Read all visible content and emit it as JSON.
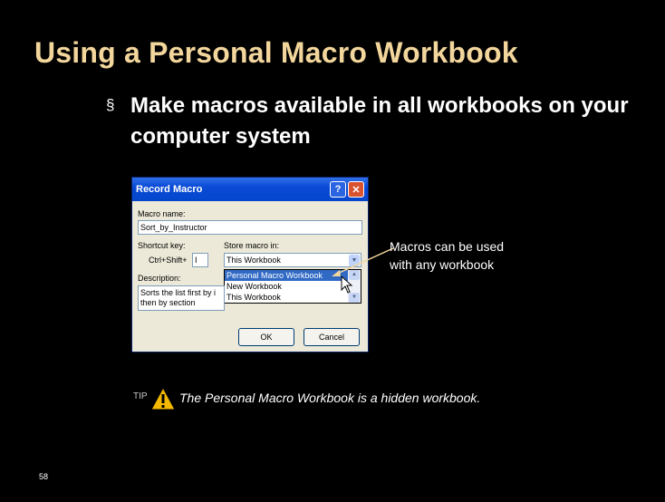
{
  "slide": {
    "title": "Using a Personal Macro Workbook",
    "bullet_marker": "§",
    "bullet_text": "Make macros available in all workbooks on your computer system",
    "page_number": "58"
  },
  "dialog": {
    "title": "Record Macro",
    "help_label": "?",
    "close_label": "✕",
    "macro_name_label": "Macro name:",
    "macro_name_value": "Sort_by_Instructor",
    "shortcut_label": "Shortcut key:",
    "shortcut_prefix": "Ctrl+Shift+",
    "shortcut_value": "I",
    "store_label": "Store macro in:",
    "store_value": "This Workbook",
    "store_options": [
      "Personal Macro Workbook",
      "New Workbook",
      "This Workbook"
    ],
    "description_label": "Description:",
    "description_line1": "Sorts the list first by i",
    "description_line2": "then by section",
    "ok_label": "OK",
    "cancel_label": "Cancel"
  },
  "callout": {
    "line1": "Macros can be used",
    "line2": "with any workbook"
  },
  "tip": {
    "label": "TIP",
    "text": "The Personal Macro Workbook is a hidden workbook."
  },
  "colors": {
    "title": "#f3d69c",
    "background": "#000000",
    "selection": "#316ac5"
  }
}
